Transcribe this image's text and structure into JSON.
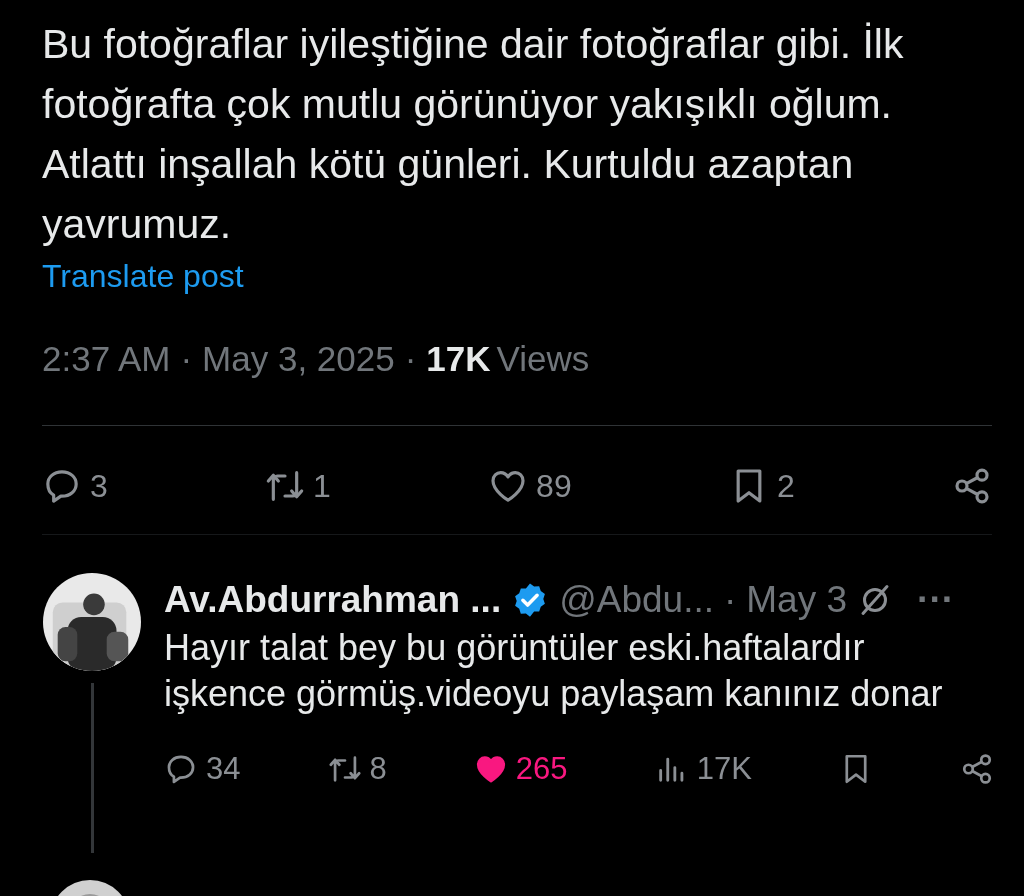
{
  "post": {
    "text": "Bu fotoğraflar iyileştiğine dair fotoğraflar gibi. İlk fotoğrafta çok mutlu görünüyor yakışıklı oğlum. Atlattı inşallah kötü günleri. Kurtuldu azaptan yavrumuz.",
    "translate": "Translate post",
    "time": "2:37 AM",
    "separator": "·",
    "date": "May 3, 2025",
    "views_count": "17K",
    "views_label": "Views",
    "actions": [
      {
        "kind": "reply",
        "count": "3"
      },
      {
        "kind": "repost",
        "count": "1"
      },
      {
        "kind": "like",
        "count": "89",
        "liked": false
      },
      {
        "kind": "bookmark",
        "count": "2"
      },
      {
        "kind": "share"
      }
    ]
  },
  "reply": {
    "name": "Av.Abdurrahman ...",
    "verified": true,
    "handle": "@Abdu...",
    "separator": "·",
    "date": "May 3",
    "more": "···",
    "text": "Hayır talat bey bu görüntüler eski.haftalardır işkence görmüş.videoyu paylaşam kanınız donar",
    "actions": [
      {
        "kind": "reply",
        "count": "34"
      },
      {
        "kind": "repost",
        "count": "8"
      },
      {
        "kind": "like",
        "count": "265",
        "liked": true
      },
      {
        "kind": "views",
        "count": "17K"
      },
      {
        "kind": "bookmark"
      },
      {
        "kind": "share"
      }
    ]
  }
}
